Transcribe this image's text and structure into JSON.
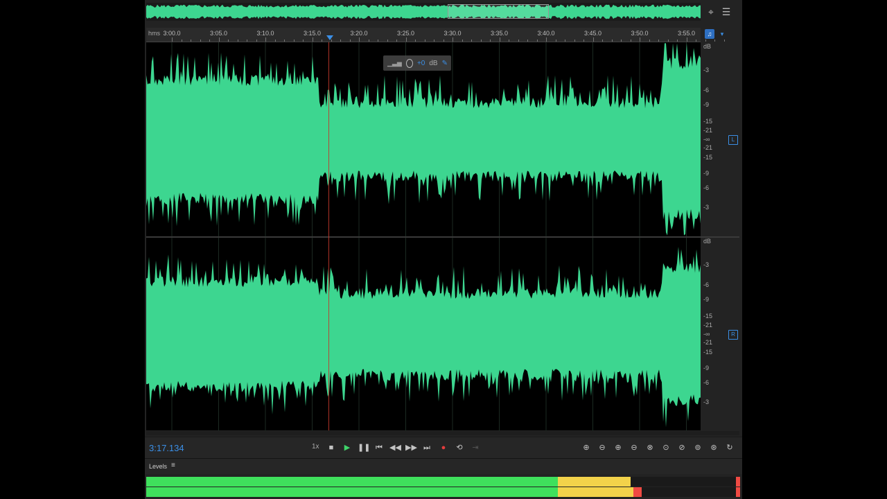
{
  "colors": {
    "waveform": "#3dd690",
    "playhead": "#c0392b",
    "accent": "#3b8fe6",
    "meter_green": "#3fe05c",
    "meter_yellow": "#f2d24a",
    "meter_red": "#ef4a43"
  },
  "ruler": {
    "unit": "hms",
    "ticks": [
      "3:00.0",
      "3:05.0",
      "3:10.0",
      "3:15.0",
      "3:20.0",
      "3:25.0",
      "3:30.0",
      "3:35.0",
      "3:40.0",
      "3:45.0",
      "3:50.0",
      "3:55.0"
    ],
    "spectral_icon": "headphones-icon",
    "marker_icon": "marker-icon"
  },
  "overview": {
    "zoom_icon": "zoom-navigator-icon",
    "menu_icon": "panel-menu-icon"
  },
  "hud": {
    "value": "+0",
    "unit": "dB"
  },
  "channels": {
    "left": {
      "label": "L",
      "db_labels": [
        "dB",
        "-3",
        "-6",
        "-9",
        "-15",
        "-21",
        "-∞",
        "-21",
        "-15",
        "-9",
        "-6",
        "-3"
      ]
    },
    "right": {
      "label": "R",
      "db_labels": [
        "dB",
        "-3",
        "-6",
        "-9",
        "-15",
        "-21",
        "-∞",
        "-21",
        "-15",
        "-9",
        "-6",
        "-3"
      ]
    }
  },
  "transport": {
    "current_time": "3:17.134",
    "playback_rate": "1x",
    "buttons": [
      "stop-icon",
      "play-icon",
      "pause-icon",
      "skip-to-start-icon",
      "rewind-icon",
      "fast-forward-icon",
      "skip-to-end-icon",
      "record-icon",
      "loop-icon",
      "skip-selection-icon"
    ],
    "zoom_buttons": [
      "zoom-in-amplitude-icon",
      "zoom-out-amplitude-icon",
      "zoom-in-time-icon",
      "zoom-out-time-icon",
      "zoom-out-full-icon",
      "zoom-in-selection-icon",
      "zoom-left-edge-icon",
      "zoom-right-edge-icon",
      "zoom-selection-icon",
      "zoom-reset-icon",
      "zoom-extra-icon"
    ]
  },
  "levels": {
    "title": "Levels",
    "menu": "≡",
    "left_level": 0.935,
    "right_level": 0.94
  }
}
